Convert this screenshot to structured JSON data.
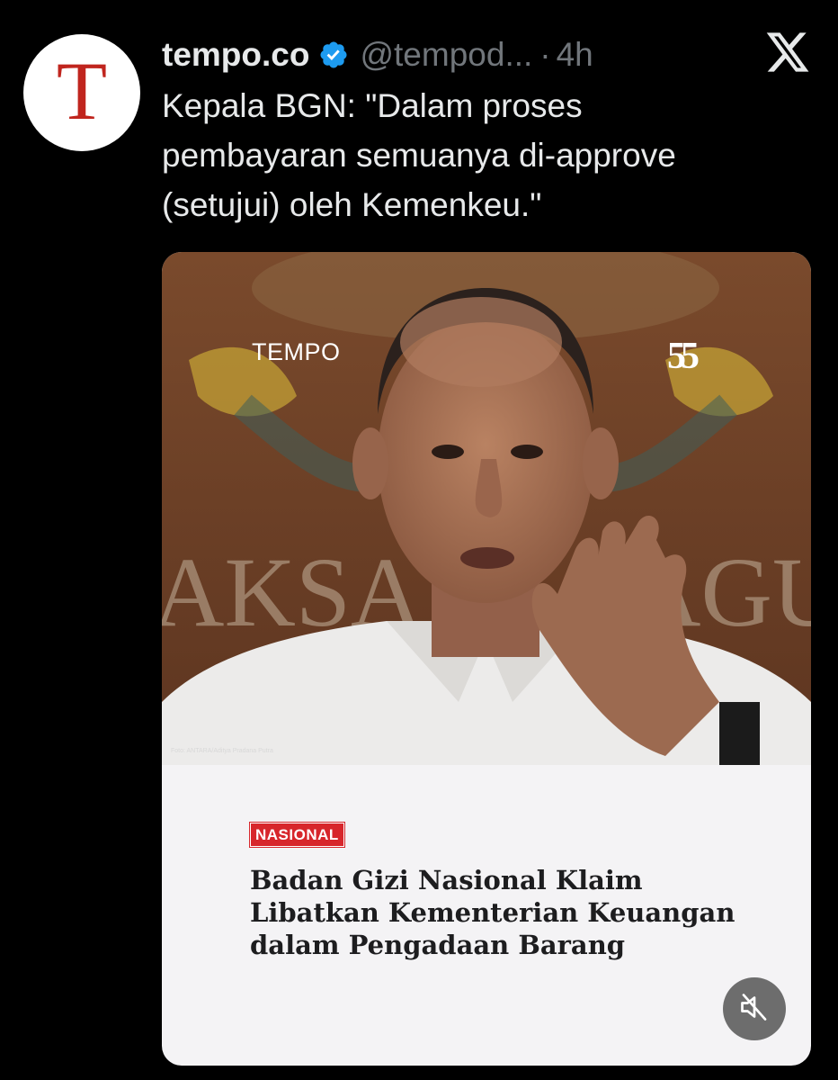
{
  "account": {
    "display_name": "tempo.co",
    "handle": "@tempod...",
    "separator": "·",
    "time": "4h",
    "avatar_letter": "T"
  },
  "tweet": {
    "text": "Kepala BGN: \"Dalam proses\npembayaran semuanya di-approve\n(setujui) oleh Kemenkeu.\""
  },
  "card": {
    "watermark": "TEMPO",
    "anniversary_mark": "55",
    "photo_credit": "Foto: ANTARA/Aditya Pradana Putra",
    "category": "NASIONAL",
    "headline": "Badan Gizi Nasional Klaim\nLibatkan Kementerian Keuangan\ndalam Pengadaan Barang"
  },
  "icons": {
    "verified": "verified-badge-icon",
    "x_logo": "x-logo-icon",
    "mute": "speaker-muted-icon"
  },
  "colors": {
    "background": "#000000",
    "text_primary": "#e7e9ea",
    "text_secondary": "#71767b",
    "verified_blue": "#1d9bf0",
    "tempo_red": "#c0251e",
    "badge_red": "#d7262b",
    "card_background": "#f4f3f5"
  }
}
